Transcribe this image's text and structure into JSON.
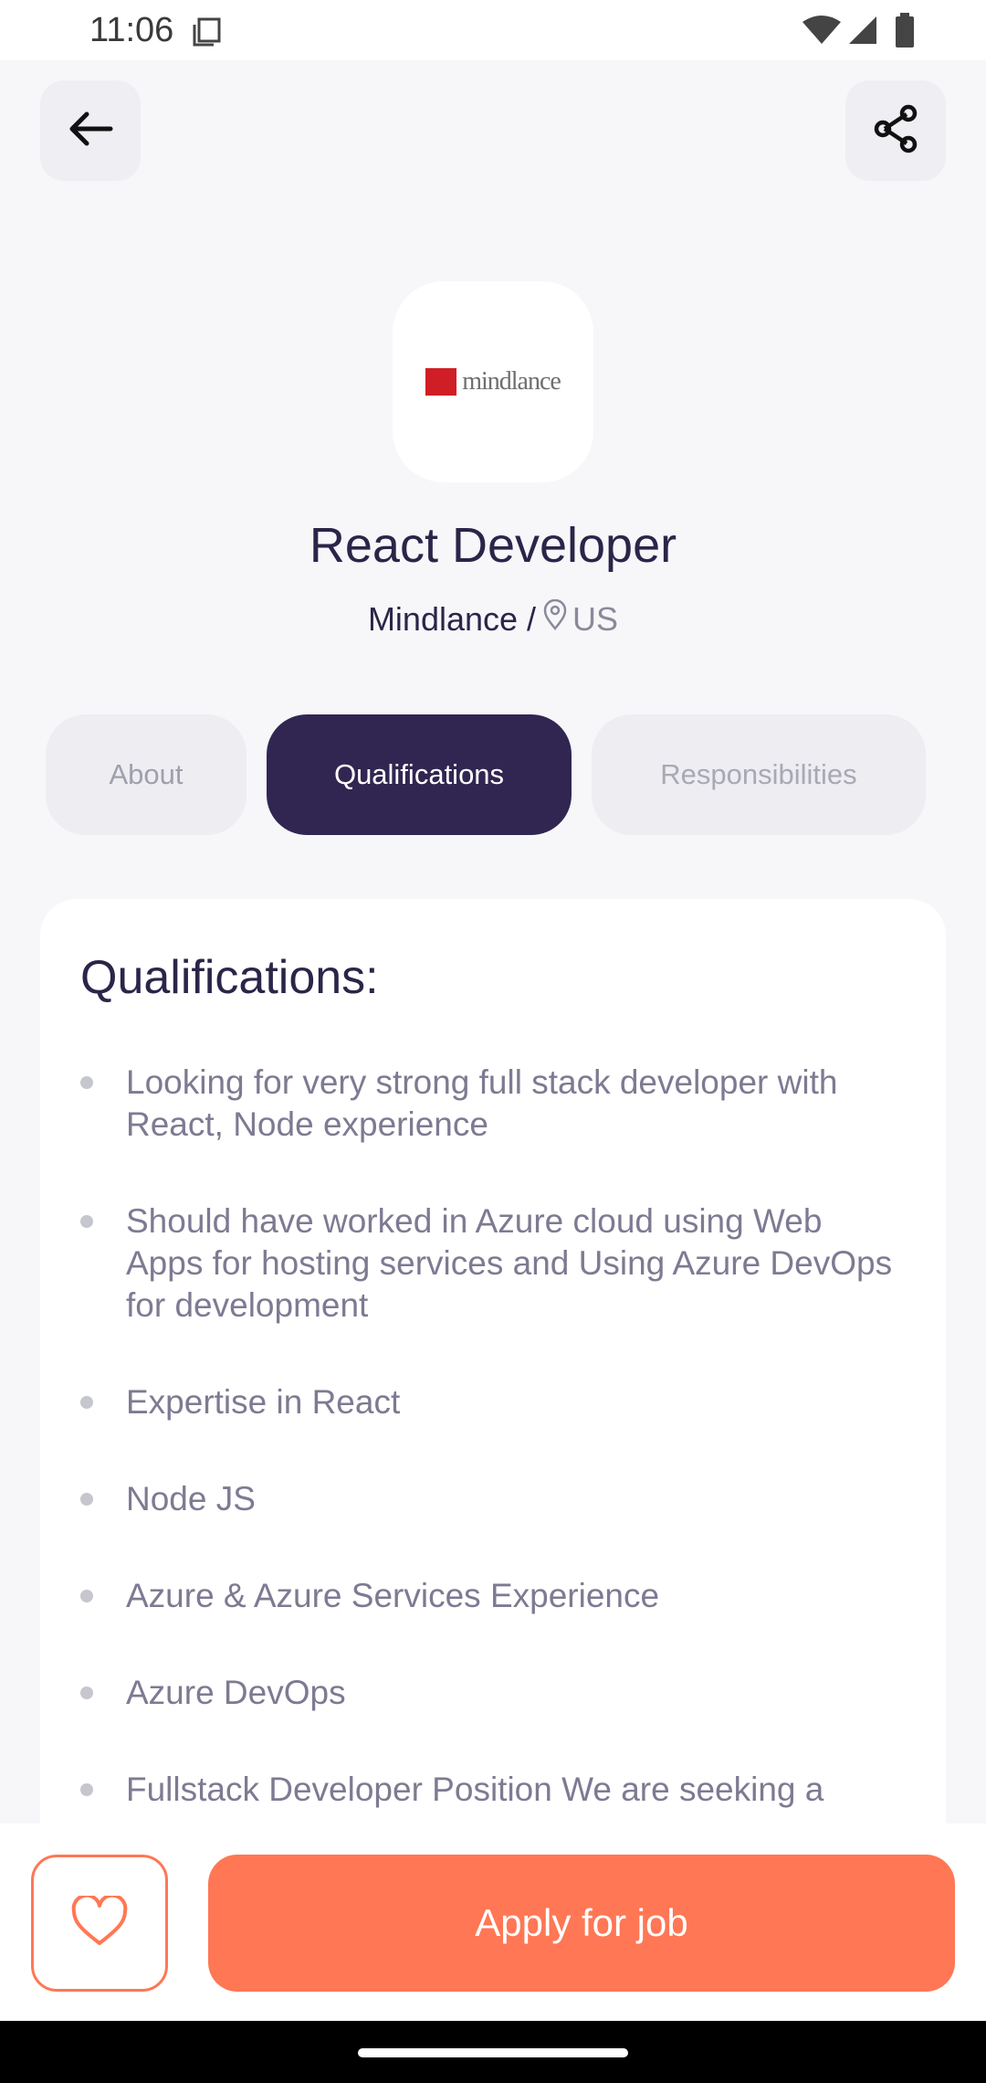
{
  "status_bar": {
    "time": "11:06",
    "icons": [
      "screenshot-icon",
      "wifi-icon",
      "signal-icon",
      "battery-icon"
    ]
  },
  "header": {
    "back_icon": "arrow-left-icon",
    "share_icon": "share-icon"
  },
  "company": {
    "logo_text": "mindlance"
  },
  "job": {
    "title": "React Developer",
    "company": "Mindlance /",
    "location": "US"
  },
  "tabs": [
    {
      "label": "About",
      "active": false
    },
    {
      "label": "Qualifications",
      "active": true
    },
    {
      "label": "Responsibilities",
      "active": false
    }
  ],
  "qualifications": {
    "title": "Qualifications:",
    "items": [
      "Looking for very strong full stack developer with React, Node experience",
      "Should have worked in Azure cloud using Web Apps for hosting services and Using Azure DevOps for development",
      "Expertise in React",
      "Node JS",
      "Azure & Azure Services Experience",
      "Azure DevOps",
      "Fullstack Developer Position We are seeking a"
    ]
  },
  "footer": {
    "favorite_icon": "heart-outline-icon",
    "apply_label": "Apply for job"
  },
  "colors": {
    "primary": "#312651",
    "accent": "#FF7754",
    "background": "#F7F7FA",
    "text_secondary": "#7E7A92"
  }
}
